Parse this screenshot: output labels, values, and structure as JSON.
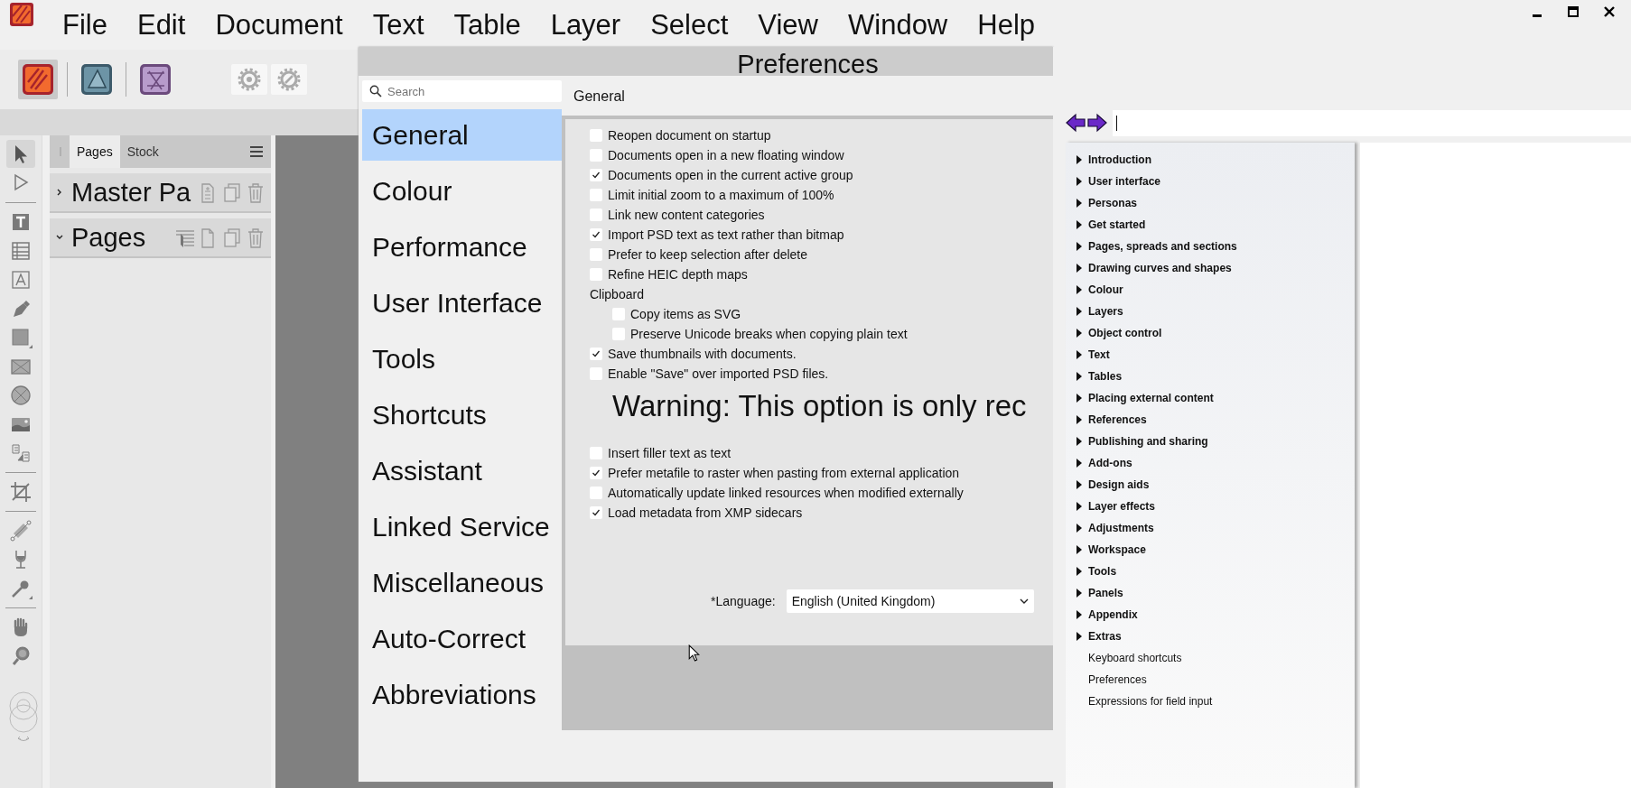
{
  "menu": [
    "File",
    "Edit",
    "Document",
    "Text",
    "Table",
    "Layer",
    "Select",
    "View",
    "Window",
    "Help"
  ],
  "personas": [
    {
      "kind": "publisher",
      "selected": true
    },
    {
      "kind": "designer",
      "selected": false
    },
    {
      "kind": "photo",
      "selected": false
    }
  ],
  "tools": [
    {
      "kind": "move",
      "selected": true
    },
    {
      "kind": "node",
      "selected": false
    },
    {
      "kind": "separator"
    },
    {
      "kind": "frametext",
      "selected": false
    },
    {
      "kind": "table",
      "selected": false
    },
    {
      "kind": "artistictext",
      "selected": false
    },
    {
      "kind": "pen",
      "selected": false
    },
    {
      "kind": "rectangle",
      "selected": false
    },
    {
      "kind": "pictureframe",
      "selected": false
    },
    {
      "kind": "ellipseframe",
      "selected": false
    },
    {
      "kind": "placeimage",
      "selected": false
    },
    {
      "kind": "textflow",
      "selected": false
    },
    {
      "kind": "separator"
    },
    {
      "kind": "crop",
      "selected": false
    },
    {
      "kind": "separator"
    },
    {
      "kind": "gradient",
      "selected": false
    },
    {
      "kind": "transparency",
      "selected": false
    },
    {
      "kind": "picker",
      "selected": false
    },
    {
      "kind": "separator"
    },
    {
      "kind": "hand",
      "selected": false
    },
    {
      "kind": "zoom",
      "selected": false
    }
  ],
  "pages_panel": {
    "tabs": [
      {
        "label": "Pages",
        "selected": true
      },
      {
        "label": "Stock",
        "selected": false
      }
    ],
    "sections": [
      {
        "title": "Master Pa",
        "expanded": false
      },
      {
        "title": "Pages",
        "expanded": true
      }
    ]
  },
  "preferences": {
    "title": "Preferences",
    "search": {
      "placeholder": "Search"
    },
    "categories": [
      {
        "label": "General",
        "selected": true
      },
      {
        "label": "Colour",
        "selected": false
      },
      {
        "label": "Performance",
        "selected": false
      },
      {
        "label": "User Interface",
        "selected": false
      },
      {
        "label": "Tools",
        "selected": false
      },
      {
        "label": "Shortcuts",
        "selected": false
      },
      {
        "label": "Assistant",
        "selected": false
      },
      {
        "label": "Linked Service",
        "selected": false
      },
      {
        "label": "Miscellaneous",
        "selected": false
      },
      {
        "label": "Auto-Correct",
        "selected": false
      },
      {
        "label": "Abbreviations",
        "selected": false
      }
    ],
    "section_title": "General",
    "options": [
      {
        "kind": "checkbox",
        "label": "Reopen document on startup",
        "checked": false
      },
      {
        "kind": "checkbox",
        "label": "Documents open in a new floating window",
        "checked": false
      },
      {
        "kind": "checkbox",
        "label": "Documents open in the current active group",
        "checked": true
      },
      {
        "kind": "checkbox",
        "label": "Limit initial zoom to a maximum of 100%",
        "checked": false
      },
      {
        "kind": "checkbox",
        "label": "Link new content categories",
        "checked": false
      },
      {
        "kind": "checkbox",
        "label": "Import PSD text as text rather than bitmap",
        "checked": true
      },
      {
        "kind": "checkbox",
        "label": "Prefer to keep selection after delete",
        "checked": false
      },
      {
        "kind": "checkbox",
        "label": "Refine HEIC depth maps",
        "checked": false
      },
      {
        "kind": "heading",
        "label": "Clipboard",
        "children": [
          {
            "kind": "checkbox",
            "label": "Copy items as SVG",
            "checked": false
          },
          {
            "kind": "checkbox",
            "label": "Preserve Unicode breaks when copying plain text",
            "checked": false
          }
        ]
      },
      {
        "kind": "checkbox",
        "label": "Save thumbnails with documents.",
        "checked": true
      },
      {
        "kind": "checkbox",
        "label": "Enable \"Save\" over imported PSD files.",
        "checked": false
      },
      {
        "kind": "warning",
        "label": "Warning: This option is only rec"
      },
      {
        "kind": "checkbox",
        "label": "Insert filler text as text",
        "checked": false
      },
      {
        "kind": "checkbox",
        "label": "Prefer metafile to raster when pasting from external application",
        "checked": true
      },
      {
        "kind": "checkbox",
        "label": "Automatically update linked resources when modified externally",
        "checked": false
      },
      {
        "kind": "checkbox",
        "label": "Load metadata from XMP sidecars",
        "checked": true
      }
    ],
    "language": {
      "label": "*Language:",
      "value": "English (United Kingdom)"
    }
  },
  "help": {
    "toc": [
      {
        "kind": "folder",
        "label": "Introduction",
        "expanded": false
      },
      {
        "kind": "folder",
        "label": "User interface",
        "expanded": false
      },
      {
        "kind": "folder",
        "label": "Personas",
        "expanded": false
      },
      {
        "kind": "folder",
        "label": "Get started",
        "expanded": false
      },
      {
        "kind": "folder",
        "label": "Pages, spreads and sections",
        "expanded": false
      },
      {
        "kind": "folder",
        "label": "Drawing curves and shapes",
        "expanded": false
      },
      {
        "kind": "folder",
        "label": "Colour",
        "expanded": false
      },
      {
        "kind": "folder",
        "label": "Layers",
        "expanded": false
      },
      {
        "kind": "folder",
        "label": "Object control",
        "expanded": false
      },
      {
        "kind": "folder",
        "label": "Text",
        "expanded": false
      },
      {
        "kind": "folder",
        "label": "Tables",
        "expanded": false
      },
      {
        "kind": "folder",
        "label": "Placing external content",
        "expanded": false
      },
      {
        "kind": "folder",
        "label": "References",
        "expanded": false
      },
      {
        "kind": "folder",
        "label": "Publishing and sharing",
        "expanded": false
      },
      {
        "kind": "folder",
        "label": "Add-ons",
        "expanded": false
      },
      {
        "kind": "folder",
        "label": "Design aids",
        "expanded": false
      },
      {
        "kind": "folder",
        "label": "Layer effects",
        "expanded": false
      },
      {
        "kind": "folder",
        "label": "Adjustments",
        "expanded": false
      },
      {
        "kind": "folder",
        "label": "Workspace",
        "expanded": false
      },
      {
        "kind": "folder",
        "label": "Tools",
        "expanded": false
      },
      {
        "kind": "folder",
        "label": "Panels",
        "expanded": false
      },
      {
        "kind": "folder",
        "label": "Appendix",
        "expanded": false
      },
      {
        "kind": "folder",
        "label": "Extras",
        "expanded": false
      },
      {
        "kind": "page",
        "label": "Keyboard shortcuts"
      },
      {
        "kind": "page",
        "label": "Preferences"
      },
      {
        "kind": "page",
        "label": "Expressions for field input"
      }
    ]
  }
}
